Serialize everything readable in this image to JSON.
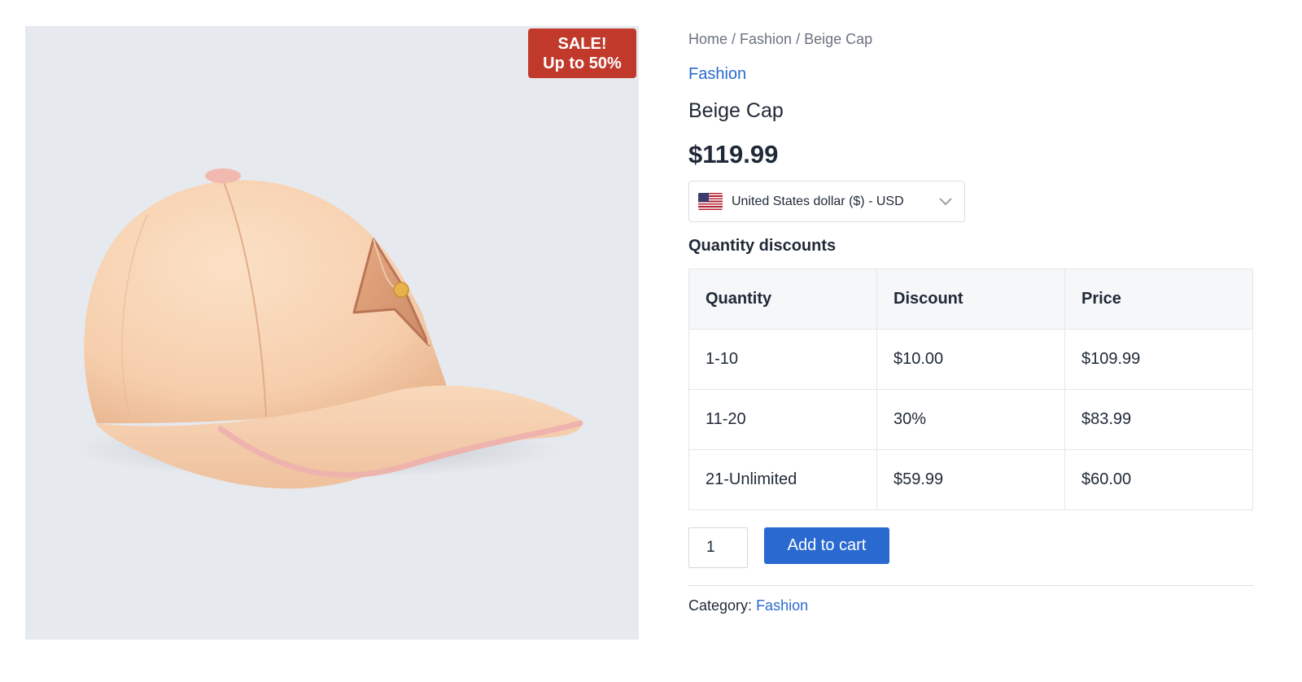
{
  "product": {
    "image_alt": "Beige Cap",
    "sale_badge": {
      "line1": "SALE!",
      "line2": "Up to 50%",
      "color": "#c0392b"
    },
    "breadcrumb": {
      "home": "Home",
      "sep1": " / ",
      "category": "Fashion",
      "sep2": " / ",
      "current": "Beige Cap"
    },
    "category_link": "Fashion",
    "title": "Beige Cap",
    "price": "$119.99",
    "currency_selector": {
      "selected": "United States dollar ($) - USD",
      "flag": "us-flag-icon"
    },
    "quantity_discounts": {
      "heading": "Quantity discounts",
      "columns": [
        "Quantity",
        "Discount",
        "Price"
      ],
      "rows": [
        [
          "1-10",
          "$10.00",
          "$109.99"
        ],
        [
          "11-20",
          "30%",
          "$83.99"
        ],
        [
          "21-Unlimited",
          "$59.99",
          "$60.00"
        ]
      ]
    },
    "quantity_value": "1",
    "add_to_cart_label": "Add to cart",
    "meta": {
      "category_label": "Category:",
      "category_value": "Fashion"
    }
  },
  "colors": {
    "accent": "#2a6ad0",
    "gallery_bg": "#e6e9ee",
    "cap": "#f7d3b4"
  }
}
